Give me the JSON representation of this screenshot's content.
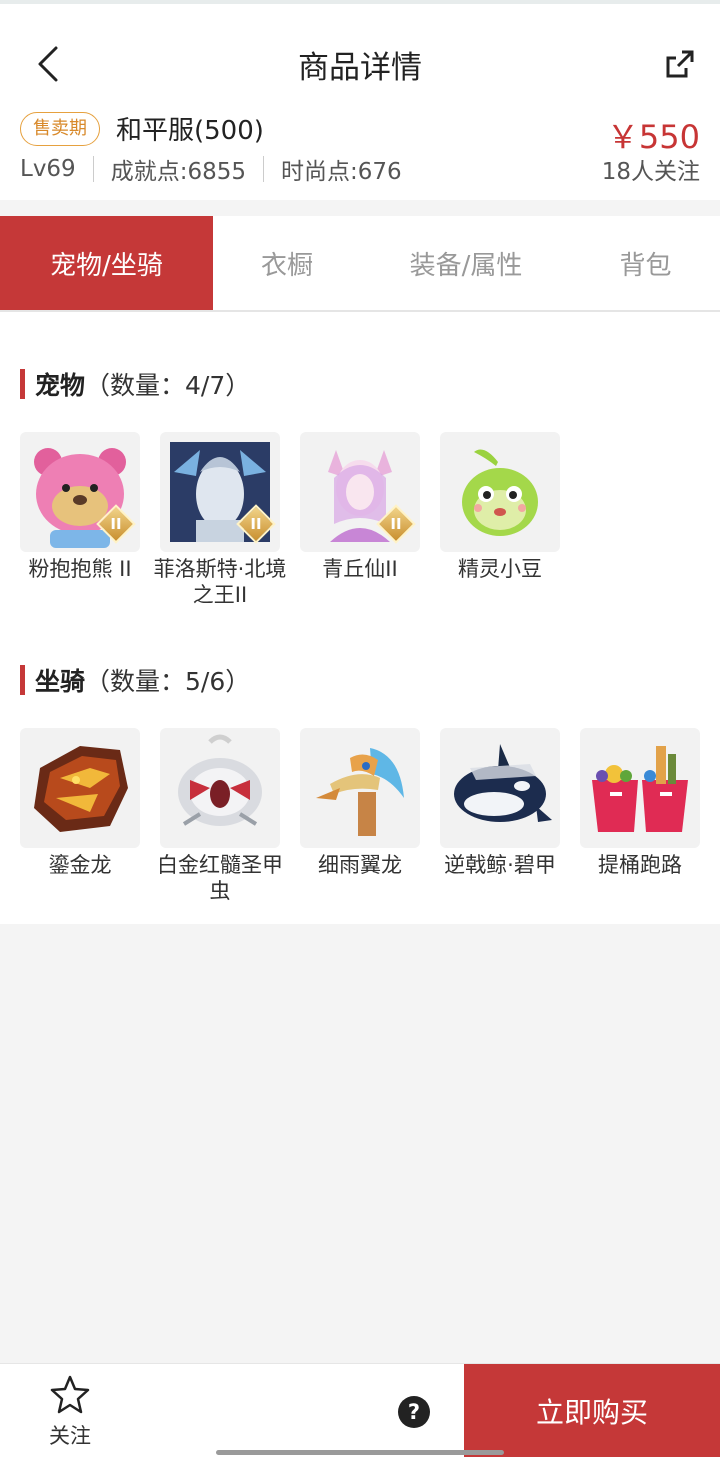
{
  "header": {
    "title": "商品详情",
    "status_badge": "售卖期",
    "server_name": "和平服(500)",
    "price": "￥550",
    "followers": "18人关注",
    "stats": [
      "Lv69",
      "成就点:6855",
      "时尚点:676"
    ]
  },
  "tabs": [
    {
      "label": "宠物/坐骑",
      "active": true
    },
    {
      "label": "衣橱",
      "active": false
    },
    {
      "label": "装备/属性",
      "active": false
    },
    {
      "label": "背包",
      "active": false
    }
  ],
  "pets": {
    "name": "宠物",
    "count": "（数量：4/7）",
    "items": [
      {
        "label": "粉抱抱熊 II",
        "icon": "pink-bear-pet-icon",
        "rank": "II"
      },
      {
        "label": "菲洛斯特·北境之王II",
        "icon": "frost-king-pet-icon",
        "rank": "II"
      },
      {
        "label": "青丘仙II",
        "icon": "fox-fairy-pet-icon",
        "rank": "II"
      },
      {
        "label": "精灵小豆",
        "icon": "green-sprout-pet-icon"
      }
    ]
  },
  "mounts": {
    "name": "坐骑",
    "count": "（数量：5/6）",
    "items": [
      {
        "label": "鎏金龙",
        "icon": "golden-dragon-mount-icon"
      },
      {
        "label": "白金红髓圣甲虫",
        "icon": "platinum-beetle-mount-icon"
      },
      {
        "label": "细雨翼龙",
        "icon": "drizzle-pterosaur-mount-icon"
      },
      {
        "label": "逆戟鲸·碧甲",
        "icon": "orca-mount-icon"
      },
      {
        "label": "提桶跑路",
        "icon": "bucket-mount-icon"
      }
    ]
  },
  "bottom_bar": {
    "follow_label": "关注",
    "help_label": "?",
    "buy_label": "立即购买"
  },
  "colors": {
    "accent": "#c53838",
    "badge": "#e6a13f"
  }
}
